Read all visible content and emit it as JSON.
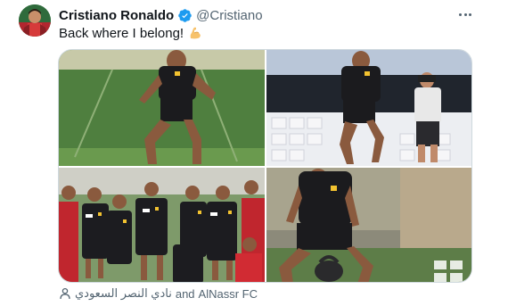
{
  "author": {
    "display_name": "Cristiano Ronaldo",
    "handle": "@Cristiano",
    "verified_icon": "verified-badge-icon",
    "avatar_color": "#2b6e3a"
  },
  "tweet": {
    "text": "Back where I belong!",
    "emoji_icon": "flexed-biceps-icon"
  },
  "media": {
    "photos": [
      {
        "scene": "player-training-sprint-grass"
      },
      {
        "scene": "player-running-stadium-seats"
      },
      {
        "scene": "team-group-photo"
      },
      {
        "scene": "player-with-kettlebell"
      }
    ]
  },
  "tags": {
    "icon": "person-tag-icon",
    "arabic": "نادي النصر السعودي",
    "joiner": "and",
    "second": "AlNassr FC"
  },
  "colors": {
    "accent": "#1d9bf0",
    "secondary_text": "#536471",
    "border": "#cfd9de"
  }
}
